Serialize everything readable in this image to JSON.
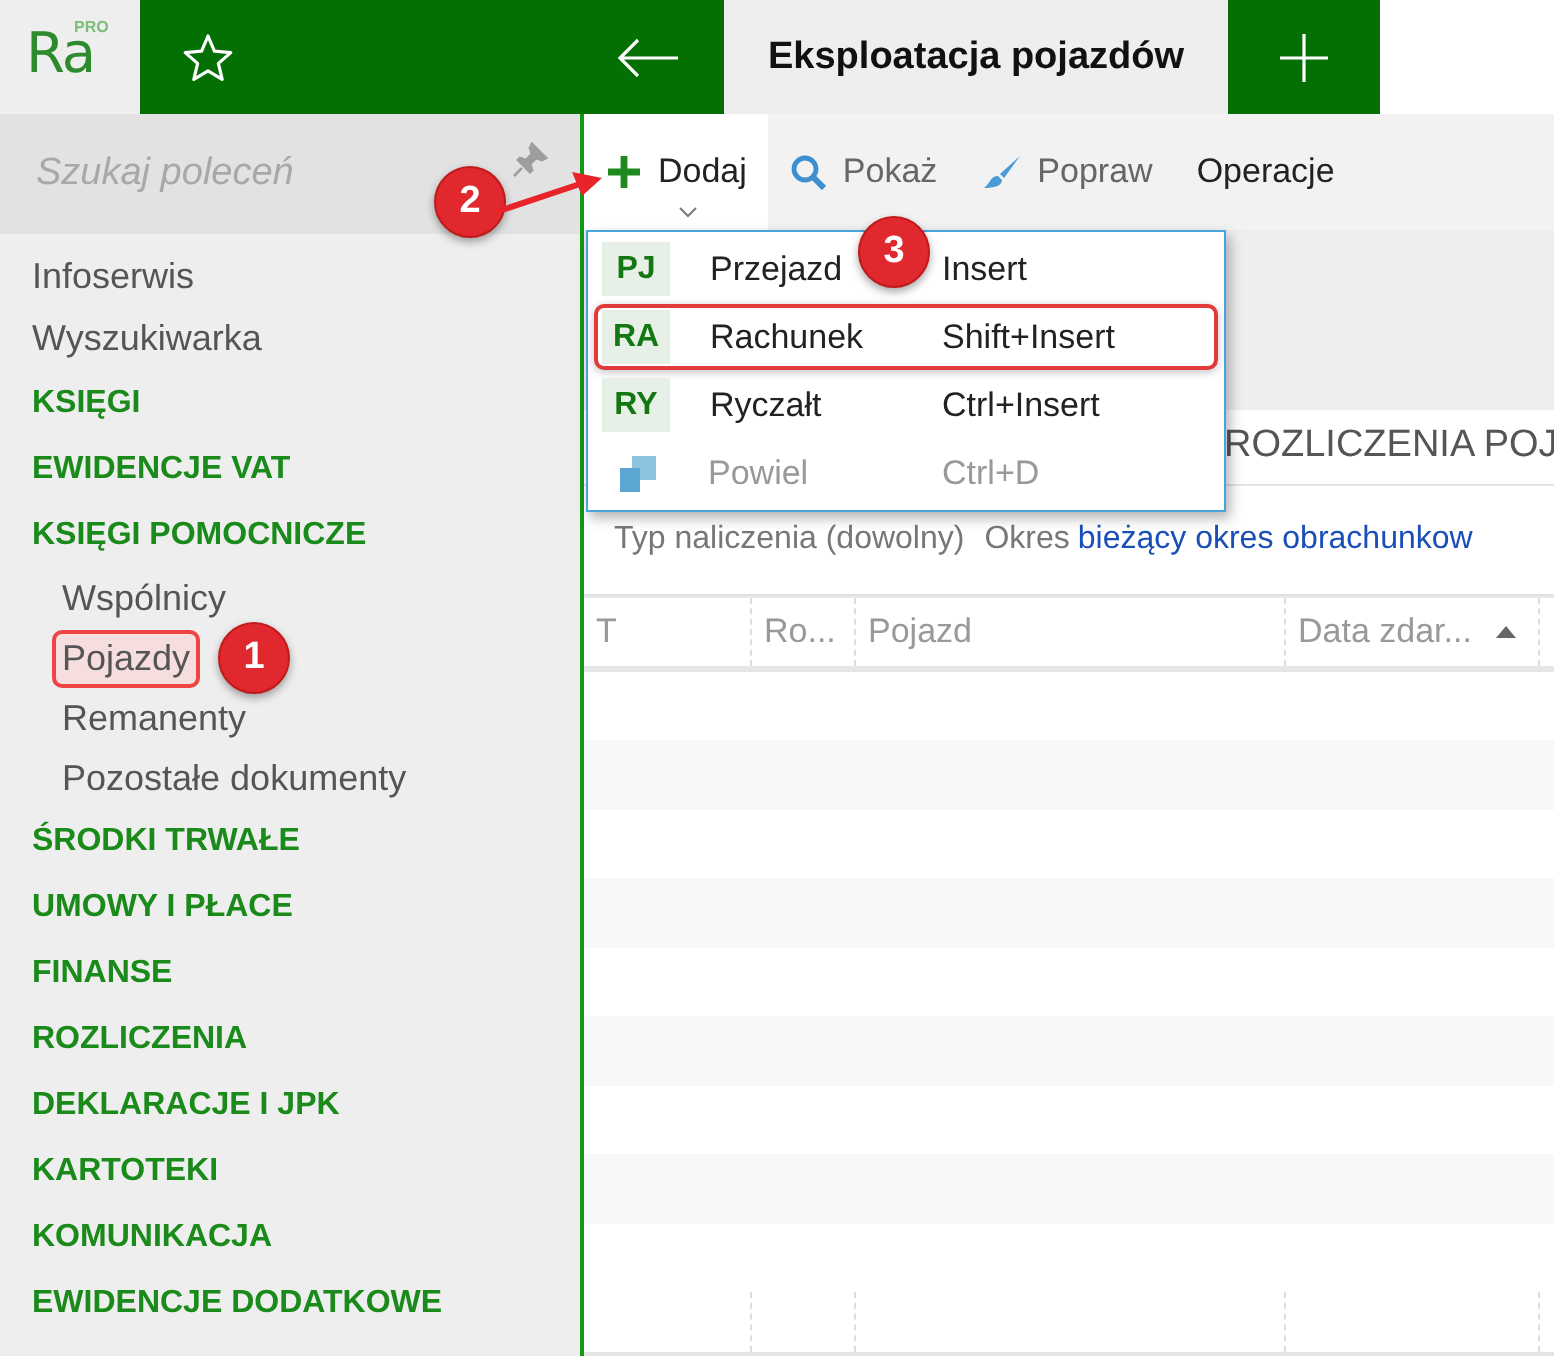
{
  "app": {
    "logo": "Ra",
    "logo_badge": "PRO"
  },
  "tabs": [
    {
      "label": "Eksploatacja pojazdów",
      "selected": true
    }
  ],
  "sidebar": {
    "search": {
      "placeholder": "Szukaj poleceń"
    },
    "items": [
      {
        "label": "Infoserwis",
        "kind": "link"
      },
      {
        "label": "Wyszukiwarka",
        "kind": "link"
      },
      {
        "label": "KSIĘGI",
        "kind": "section"
      },
      {
        "label": "EWIDENCJE VAT",
        "kind": "section"
      },
      {
        "label": "KSIĘGI POMOCNICZE",
        "kind": "section",
        "children": [
          {
            "label": "Wspólnicy",
            "selected": false
          },
          {
            "label": "Pojazdy",
            "selected": true
          },
          {
            "label": "Remanenty",
            "selected": false
          },
          {
            "label": "Pozostałe dokumenty",
            "selected": false
          }
        ]
      },
      {
        "label": "ŚRODKI TRWAŁE",
        "kind": "section"
      },
      {
        "label": "UMOWY I PŁACE",
        "kind": "section"
      },
      {
        "label": "FINANSE",
        "kind": "section"
      },
      {
        "label": "ROZLICZENIA",
        "kind": "section"
      },
      {
        "label": "DEKLARACJE I JPK",
        "kind": "section"
      },
      {
        "label": "KARTOTEKI",
        "kind": "section"
      },
      {
        "label": "KOMUNIKACJA",
        "kind": "section"
      },
      {
        "label": "EWIDENCJE DODATKOWE",
        "kind": "section"
      }
    ]
  },
  "toolbar": [
    {
      "label": "Dodaj",
      "kind": "add",
      "expanded": true
    },
    {
      "label": "Pokaż",
      "kind": "show",
      "expanded": false
    },
    {
      "label": "Popraw",
      "kind": "edit",
      "expanded": false
    },
    {
      "label": "Operacje",
      "kind": "menu",
      "expanded": false
    }
  ],
  "menu": {
    "items": [
      {
        "kind": "code",
        "code": "PJ",
        "label": "Przejazd",
        "shortcut": "Insert",
        "disabled": false,
        "highlighted": false
      },
      {
        "kind": "code",
        "code": "RA",
        "label": "Rachunek",
        "shortcut": "Shift+Insert",
        "disabled": false,
        "highlighted": true
      },
      {
        "kind": "code",
        "code": "RY",
        "label": "Ryczałt",
        "shortcut": "Ctrl+Insert",
        "disabled": false,
        "highlighted": false
      },
      {
        "kind": "copy",
        "label": "Powiel",
        "shortcut": "Ctrl+D",
        "disabled": true,
        "highlighted": false
      }
    ]
  },
  "section_title": "ROZLICZENIA POJ",
  "filters": {
    "type": "Typ naliczenia (dowolny)",
    "period_label": "Okres",
    "period_value": "bieżący okres obrachunkow"
  },
  "table": {
    "columns": [
      {
        "label": "T"
      },
      {
        "label": "Ro..."
      },
      {
        "label": "Pojazd"
      },
      {
        "label": "Data zdar...",
        "sorted": true
      }
    ]
  },
  "annotations": [
    {
      "number": "1"
    },
    {
      "number": "2"
    },
    {
      "number": "3"
    }
  ]
}
